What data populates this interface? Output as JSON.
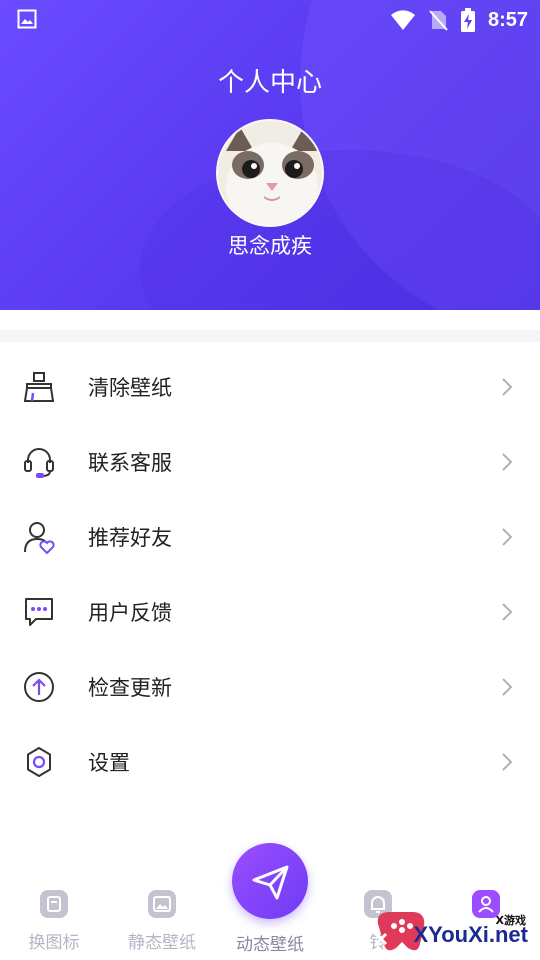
{
  "status_bar": {
    "time": "8:57"
  },
  "profile": {
    "title": "个人中心",
    "username": "思念成疾"
  },
  "menu": [
    {
      "label": "清除壁纸",
      "icon": "broom-icon"
    },
    {
      "label": "联系客服",
      "icon": "headset-icon"
    },
    {
      "label": "推荐好友",
      "icon": "user-heart-icon"
    },
    {
      "label": "用户反馈",
      "icon": "chat-bubble-icon"
    },
    {
      "label": "检查更新",
      "icon": "arrow-up-circle-icon"
    },
    {
      "label": "设置",
      "icon": "gear-icon"
    }
  ],
  "bottom_nav": {
    "items": [
      {
        "label": "换图标",
        "icon": "change-icon-icon"
      },
      {
        "label": "静态壁纸",
        "icon": "image-icon"
      },
      {
        "label": "动态壁纸",
        "icon": "paper-plane-icon"
      },
      {
        "label": "铃",
        "icon": "bell-icon"
      },
      {
        "label": "",
        "icon": "user-icon"
      }
    ]
  },
  "watermark": {
    "small": "X游戏",
    "big": "XYouXi.net"
  },
  "colors": {
    "accent": "#5b3cf2",
    "nav_center": "#7a3ff7",
    "inactive": "#b7b5c4"
  }
}
